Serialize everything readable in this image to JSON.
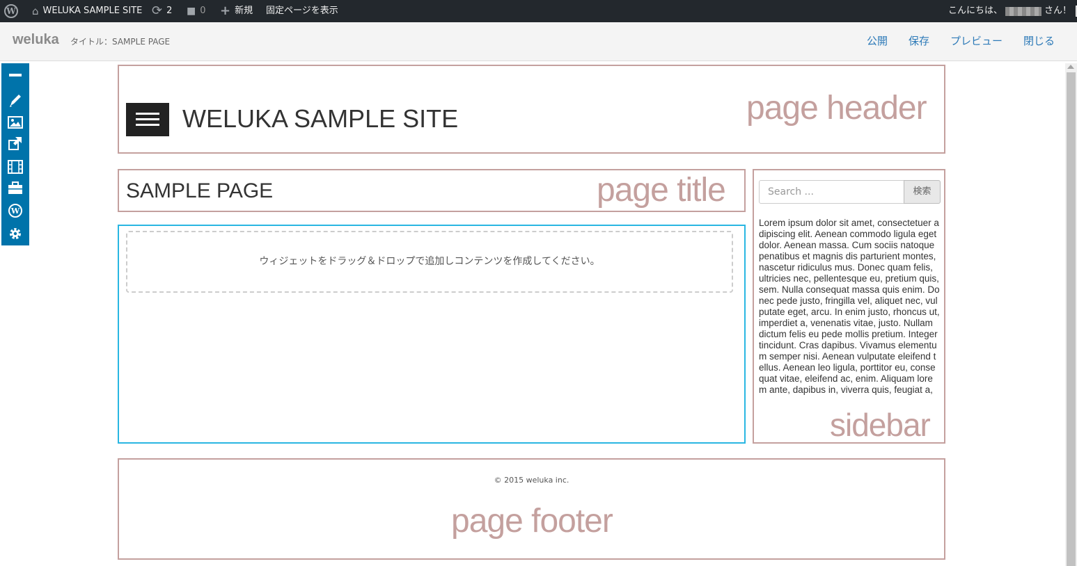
{
  "adminbar": {
    "site_name": "WELUKA SAMPLE SITE",
    "updates_count": "2",
    "comments_count": "0",
    "new_label": "新規",
    "view_page_label": "固定ページを表示",
    "greeting_prefix": "こんにちは、",
    "greeting_suffix": "さん！",
    "icons": [
      "wordpress-icon",
      "home-icon",
      "refresh-icon",
      "comment-icon",
      "plus-icon",
      "avatar-icon"
    ]
  },
  "builder": {
    "brand": "weluka",
    "title_crumb": "タイトル：SAMPLE PAGE",
    "actions": {
      "publish": "公開",
      "save": "保存",
      "preview": "プレビュー",
      "close": "閉じる"
    },
    "accent_color": "#0073aa"
  },
  "palette": {
    "tools": [
      "minus-icon",
      "pencil-icon",
      "image-icon",
      "external-link-icon",
      "film-icon",
      "briefcase-icon",
      "wordpress-icon",
      "gear-icon"
    ]
  },
  "page": {
    "header_label": "page header",
    "site_title": "WELUKA SAMPLE SITE",
    "page_title_label": "page title",
    "page_title": "SAMPLE PAGE",
    "dropzone_text": "ウィジェットをドラッグ＆ドロップで追加しコンテンツを作成してください。",
    "sidebar_label": "sidebar",
    "search_placeholder": "Search ...",
    "search_button": "検索",
    "sidebar_text": "Lorem ipsum dolor sit amet, consectetuer adipiscing elit. Aenean commodo ligula eget dolor. Aenean massa. Cum sociis natoque penatibus et magnis dis parturient montes, nascetur ridiculus mus. Donec quam felis, ultricies nec, pellentesque eu, pretium quis, sem. Nulla consequat massa quis enim. Donec pede justo, fringilla vel, aliquet nec, vulputate eget, arcu. In enim justo, rhoncus ut, imperdiet a, venenatis vitae, justo. Nullam dictum felis eu pede mollis pretium. Integer tincidunt. Cras dapibus. Vivamus elementum semper nisi. Aenean vulputate eleifend tellus. Aenean leo ligula, porttitor eu, consequat vitae, eleifend ac, enim. Aliquam lorem ante, dapibus in, viverra quis, feugiat a,",
    "copyright": "© 2015 weluka inc.",
    "footer_label": "page footer",
    "frame_color": "#c4a09e",
    "active_color": "#29b6e2"
  }
}
